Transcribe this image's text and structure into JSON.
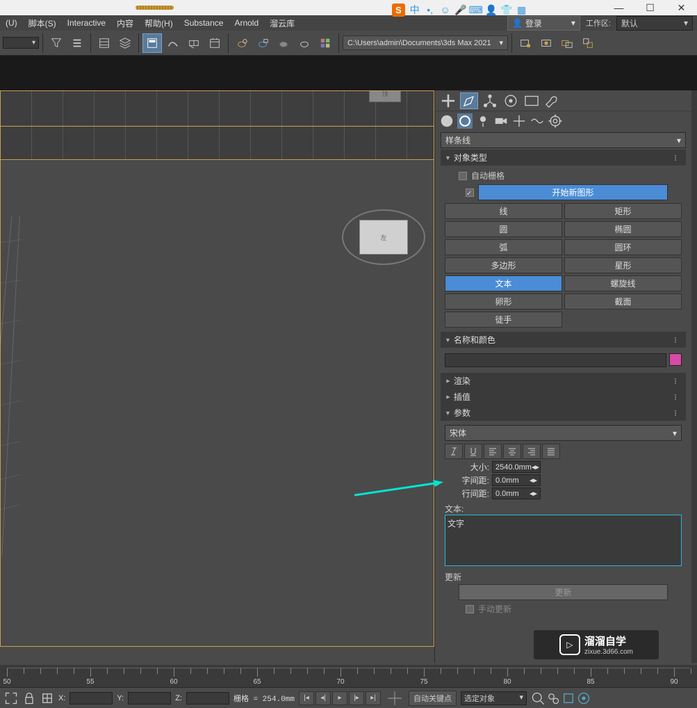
{
  "titlebar": {
    "min": "—",
    "max": "☐",
    "close": "✕"
  },
  "sogou": {
    "badge": "S",
    "lang": "中"
  },
  "menu": {
    "items": [
      "(U)",
      "脚本(S)",
      "Interactive",
      "内容",
      "帮助(H)",
      "Substance",
      "Arnold",
      "溜云库"
    ],
    "login": "登录",
    "workspace_label": "工作区:",
    "workspace_value": "默认"
  },
  "toolbar": {
    "path": "C:\\Users\\admin\\Documents\\3ds Max 2021"
  },
  "panel": {
    "category": "样条线",
    "rollouts": {
      "object_type": "对象类型",
      "auto_grid": "自动栅格",
      "start_new": "开始新图形",
      "buttons": [
        "线",
        "矩形",
        "圆",
        "椭圆",
        "弧",
        "圆环",
        "多边形",
        "星形",
        "文本",
        "螺旋线",
        "卵形",
        "截面",
        "徒手"
      ],
      "name_color": "名称和颜色",
      "render": "渲染",
      "interp": "插值",
      "params": "参数",
      "font": "宋体",
      "size_label": "大小:",
      "size_val": "2540.0mm",
      "kerning_label": "字间距:",
      "kerning_val": "0.0mm",
      "leading_label": "行间距:",
      "leading_val": "0.0mm",
      "text_label": "文本:",
      "text_val": "文字",
      "update": "更新",
      "manual_update": "手动更新"
    }
  },
  "timeline": {
    "ticks": [
      50,
      55,
      60,
      65,
      70,
      75,
      80,
      85,
      90
    ]
  },
  "statusbar": {
    "x": "X:",
    "y": "Y:",
    "z": "Z:",
    "grid": "栅格 = 254.0mm",
    "autokey": "自动关键点",
    "selection": "选定对象"
  },
  "watermark": {
    "text": "溜溜自学",
    "url": "zixue.3d66.com"
  }
}
